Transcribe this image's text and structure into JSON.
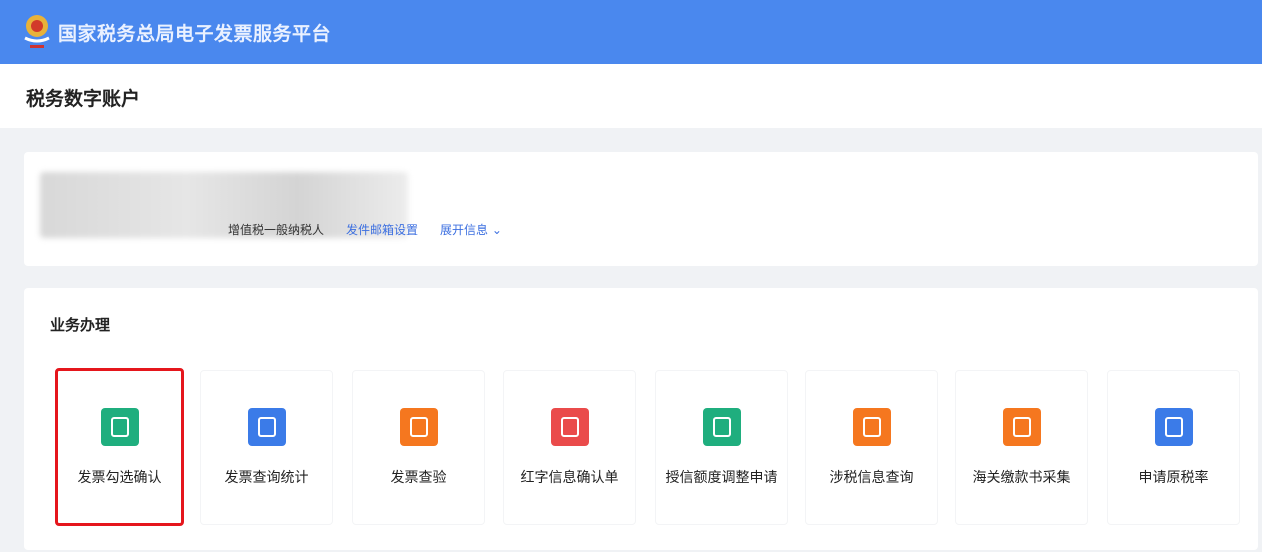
{
  "header": {
    "title": "国家税务总局电子发票服务平台"
  },
  "page": {
    "title": "税务数字账户"
  },
  "account": {
    "taxpayer_type": "增值税一般纳税人",
    "email_link": "发件邮箱设置",
    "expand_link": "展开信息"
  },
  "business": {
    "heading": "业务办理",
    "items": [
      {
        "label": "发票勾选确认",
        "icon": "invoice-check-icon",
        "color": "#1fae7e"
      },
      {
        "label": "发票查询统计",
        "icon": "invoice-search-icon",
        "color": "#3b7be8"
      },
      {
        "label": "发票查验",
        "icon": "invoice-verify-icon",
        "color": "#f5771f"
      },
      {
        "label": "红字信息确认单",
        "icon": "red-letter-icon",
        "color": "#ea4b4b"
      },
      {
        "label": "授信额度调整申请",
        "icon": "credit-adjust-icon",
        "color": "#1fae7e"
      },
      {
        "label": "涉税信息查询",
        "icon": "tax-info-icon",
        "color": "#f5771f"
      },
      {
        "label": "海关缴款书采集",
        "icon": "customs-icon",
        "color": "#f5771f"
      },
      {
        "label": "申请原税率",
        "icon": "tax-rate-icon",
        "color": "#3b7be8"
      }
    ]
  }
}
